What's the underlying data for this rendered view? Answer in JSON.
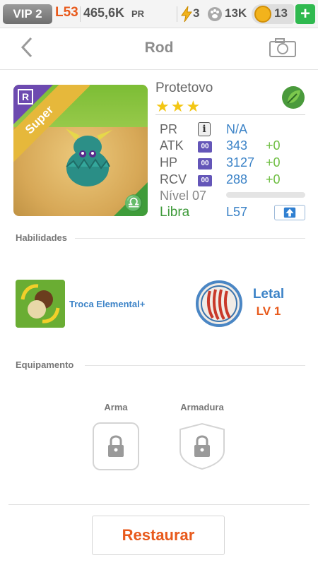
{
  "status_bar": {
    "vip": "VIP 2",
    "level": "L53",
    "pr_value": "465,6K",
    "pr_unit": "PR",
    "energy": "3",
    "paw": "13K",
    "coins": "13",
    "plus": "+"
  },
  "header": {
    "title": "Rod",
    "back_icon": "chevron-left-icon",
    "camera_icon": "camera-icon"
  },
  "card": {
    "rarity_letter": "R",
    "label": "Super",
    "zodiac_symbol": "♎"
  },
  "pet": {
    "name": "Protetovo",
    "stars": "★★★",
    "element_icon": "leaf-icon"
  },
  "stats": [
    {
      "label": "PR",
      "icon": "i",
      "value": "N/A",
      "bonus": ""
    },
    {
      "label": "ATK",
      "icon": "00",
      "value": "343",
      "bonus": "+0"
    },
    {
      "label": "HP",
      "icon": "00",
      "value": "3127",
      "bonus": "+0"
    },
    {
      "label": "RCV",
      "icon": "00",
      "value": "288",
      "bonus": "+0"
    }
  ],
  "level": {
    "label": "Nível 07",
    "progress": 0
  },
  "zodiac": {
    "name": "Libra",
    "required_level": "L57"
  },
  "skills_section": {
    "title": "Habilidades"
  },
  "skills": [
    {
      "name": "Troca Elemental+",
      "level": ""
    },
    {
      "name": "Letal",
      "level": "LV 1"
    }
  ],
  "equipment_section": {
    "title": "Equipamento"
  },
  "equipment": [
    {
      "label": "Arma",
      "icon": "lock-icon"
    },
    {
      "label": "Armadura",
      "icon": "lock-icon"
    }
  ],
  "actions": {
    "restore": "Restaurar"
  },
  "colors": {
    "accent_orange": "#e85a1c",
    "stat_blue": "#3c83c7",
    "bonus_green": "#6cbd3f",
    "star_yellow": "#f3c613",
    "rarity_purple": "#6d4ab0",
    "zodiac_green": "#3e9a3a"
  }
}
